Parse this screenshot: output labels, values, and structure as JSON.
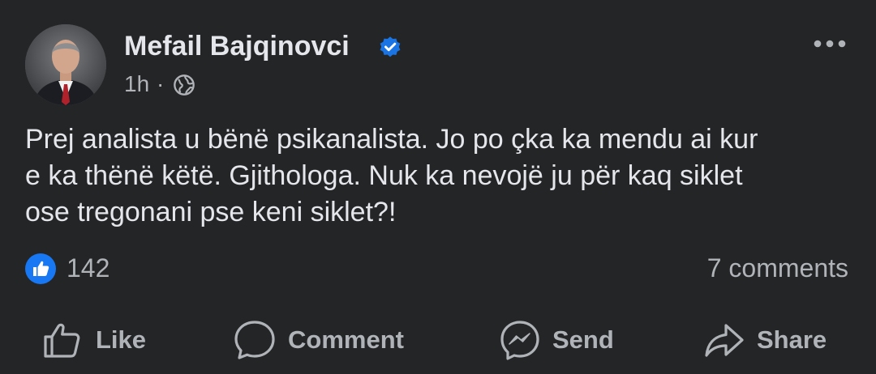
{
  "post": {
    "author_name": "Mefail Bajqinovci",
    "time_ago": "1h",
    "separator": "·",
    "text_lines": [
      "Prej analista u bënë psikanalista. Jo po çka ka mendu ai kur",
      "e ka thënë këtë. Gjithologa. Nuk ka nevojë ju për kaq siklet",
      "ose tregonani pse keni siklet?!"
    ],
    "reaction_count": "142",
    "comments_count": "7 comments"
  },
  "actions": {
    "like": "Like",
    "comment": "Comment",
    "send": "Send",
    "share": "Share"
  },
  "icons": {
    "verified": "verified-badge-icon",
    "audience": "globe-icon",
    "more": "more-horizontal-icon",
    "reaction": "like-reaction-icon"
  },
  "colors": {
    "background": "#242526",
    "primary_text": "#e4e6eb",
    "secondary_text": "#b0b3b8",
    "accent_blue": "#1b74e4",
    "like_blue": "#1877f2"
  }
}
